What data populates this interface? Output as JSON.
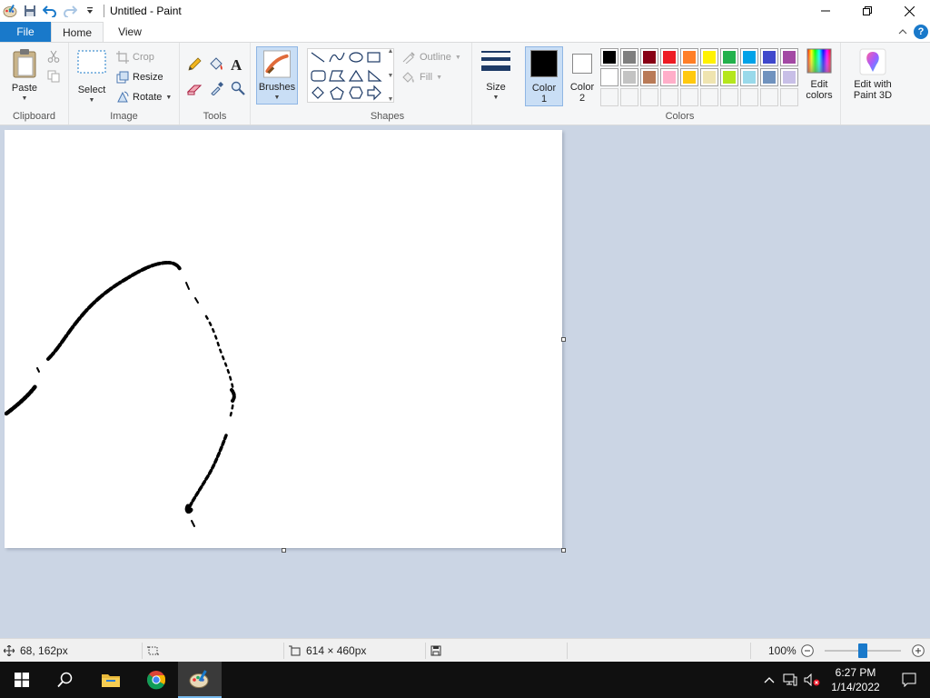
{
  "window": {
    "title": "Untitled - Paint"
  },
  "tabs": {
    "file": "File",
    "home": "Home",
    "view": "View"
  },
  "clipboard": {
    "paste": "Paste",
    "label": "Clipboard"
  },
  "image": {
    "select": "Select",
    "crop": "Crop",
    "resize": "Resize",
    "rotate": "Rotate",
    "label": "Image"
  },
  "tools": {
    "label": "Tools"
  },
  "brushes": {
    "label": "Brushes"
  },
  "shapes": {
    "outline": "Outline",
    "fill": "Fill",
    "label": "Shapes"
  },
  "size": {
    "label": "Size"
  },
  "colors": {
    "color1": "Color\n1",
    "color1_label": "Color",
    "color1_num": "1",
    "color2_label": "Color",
    "color2_num": "2",
    "edit_colors_1": "Edit",
    "edit_colors_2": "colors",
    "edit3d_1": "Edit with",
    "edit3d_2": "Paint 3D",
    "label": "Colors",
    "color1_value": "#000000",
    "color2_value": "#ffffff",
    "palette_row1": [
      "#000000",
      "#7f7f7f",
      "#880015",
      "#ed1c24",
      "#ff7f27",
      "#fff200",
      "#22b14c",
      "#00a2e8",
      "#3f48cc",
      "#a349a4"
    ],
    "palette_row2": [
      "#ffffff",
      "#c3c3c3",
      "#b97a57",
      "#ffaec9",
      "#ffc90e",
      "#efe4b0",
      "#b5e61d",
      "#99d9ea",
      "#7092be",
      "#c8bfe7"
    ]
  },
  "status": {
    "cursor_pos": "68, 162px",
    "canvas_size": "614 × 460px",
    "zoom": "100%",
    "zoom_fraction": 0.5
  },
  "taskbar": {
    "time": "6:27 PM",
    "date": "1/14/2022"
  }
}
